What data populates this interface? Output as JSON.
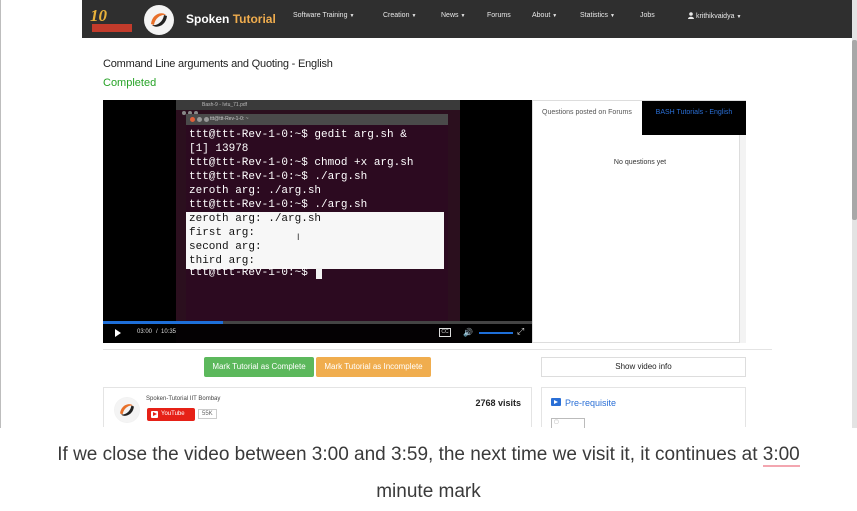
{
  "navbar": {
    "anniversary_text": "10",
    "brand_main": "Spoken",
    "brand_accent": "Tutorial",
    "menu": [
      {
        "label": "Software Training",
        "dropdown": true
      },
      {
        "label": "Creation",
        "dropdown": true
      },
      {
        "label": "News",
        "dropdown": true
      },
      {
        "label": "Forums",
        "dropdown": false
      },
      {
        "label": "About",
        "dropdown": true
      },
      {
        "label": "Statistics",
        "dropdown": true
      },
      {
        "label": "Jobs",
        "dropdown": false
      }
    ],
    "user": "krithikvaidya",
    "colors": {
      "background": "#2f2f2f",
      "accent": "#f0ad4e"
    }
  },
  "tutorial": {
    "title": "Command Line arguments and Quoting - English",
    "status": "Completed"
  },
  "video": {
    "desktop_title": "Bash-9 - Ivtu_71.pdf",
    "terminal_title": "ttt@ttt-Rev-1-0: ~",
    "terminal_dark_lines": [
      "ttt@ttt-Rev-1-0:~$ gedit arg.sh &",
      "[1] 13978",
      "ttt@ttt-Rev-1-0:~$ chmod +x arg.sh",
      "ttt@ttt-Rev-1-0:~$ ./arg.sh",
      "zeroth arg: ./arg.sh",
      "ttt@ttt-Rev-1-0:~$ ./arg.sh"
    ],
    "terminal_light_lines": [
      "zeroth arg: ./arg.sh",
      "first arg:",
      "second arg:",
      "third arg:"
    ],
    "terminal_prompt": "ttt@ttt-Rev-1-0:~$",
    "current_time": "03:00",
    "duration": "10:35",
    "progress_fraction": 0.28,
    "cc_label": "CC"
  },
  "questions_panel": {
    "tab_left": "Questions posted on Forums",
    "tab_right": "BASH Tutorials - English",
    "empty_message": "No questions yet"
  },
  "actions": {
    "mark_complete": "Mark Tutorial as Complete",
    "mark_incomplete": "Mark Tutorial as Incomplete",
    "show_info": "Show video info",
    "colors": {
      "complete": "#5cb85c",
      "incomplete": "#f0ad4e"
    }
  },
  "channel": {
    "name": "Spoken-Tutorial IIT Bombay",
    "youtube_label": "YouTube",
    "subscribers": "55K",
    "visits": "2768 visits"
  },
  "prerequisite": {
    "label": "Pre-requisite"
  },
  "caption": {
    "line1_before": "If we close the video between 3:00 and 3:59, the next time we visit it, it continues at ",
    "line1_highlight": "3:00",
    "line2": "minute mark"
  }
}
